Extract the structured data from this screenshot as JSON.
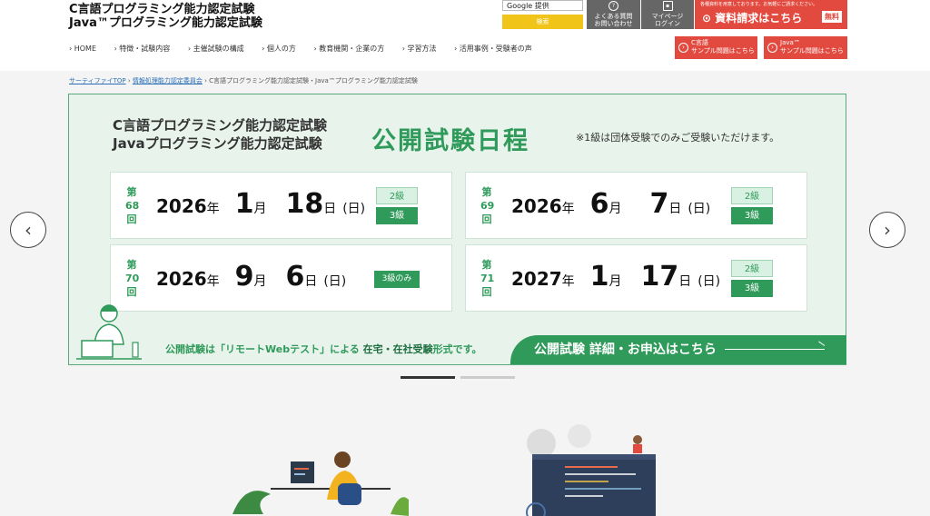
{
  "header": {
    "title_line1": "C言語プログラミング能力認定試験",
    "title_line2": "Java™プログラミング能力認定試験",
    "search_brand": "Google 提供",
    "search_button": "検索",
    "faq_label": "よくある質問\nお問い合わせ",
    "faq_line1": "よくある質問",
    "faq_line2": "お問い合わせ",
    "mypage_line1": "マイページ",
    "mypage_line2": "ログイン",
    "docreq_note": "各種資料を用意しております。お気軽にご請求ください。",
    "docreq_label": "資料請求はこちら",
    "docreq_free": "無料",
    "sample_c_line1": "C言語",
    "sample_c_line2": "サンプル問題はこちら",
    "sample_java_line1": "Java™",
    "sample_java_line2": "サンプル問題はこちら"
  },
  "nav": [
    "› HOME",
    "› 特徴・試験内容",
    "› 主催試験の構成",
    "› 個人の方",
    "› 教育機関・企業の方",
    "› 学習方法",
    "› 活用事例・受験者の声"
  ],
  "breadcrumb": {
    "item1": "サーティファイTOP",
    "item2": "情報処理能力認定委員会",
    "current": "C言語プログラミング能力認定試験・Java™プログラミング能力認定試験",
    "sep": "›"
  },
  "banner": {
    "title_line1": "C言語プログラミング能力認定試験",
    "title_line2": "Javaプログラミング能力認定試験",
    "heading": "公開試験日程",
    "note": "※1級は団体受験でのみご受験いただけます。",
    "sessions": [
      {
        "dai": "第",
        "num": "68",
        "kai": "回",
        "year": "2026",
        "month": "1",
        "day": "18",
        "weekday": "日",
        "grades": [
          "2級",
          "3級"
        ]
      },
      {
        "dai": "第",
        "num": "69",
        "kai": "回",
        "year": "2026",
        "month": "6",
        "day": "7",
        "weekday": "日",
        "grades": [
          "2級",
          "3級"
        ]
      },
      {
        "dai": "第",
        "num": "70",
        "kai": "回",
        "year": "2026",
        "month": "9",
        "day": "6",
        "weekday": "日",
        "grades": [
          "3級のみ"
        ]
      },
      {
        "dai": "第",
        "num": "71",
        "kai": "回",
        "year": "2027",
        "month": "1",
        "day": "17",
        "weekday": "日",
        "grades": [
          "2級",
          "3級"
        ]
      }
    ],
    "units": {
      "year": "年",
      "month": "月",
      "day": "日"
    },
    "foot_text_a": "公開試験は「リモートWebテスト」による",
    "foot_text_b": "在宅・在社受験",
    "foot_text_c": "形式です。",
    "cta": "公開試験 詳細・お申込はこちら"
  },
  "carousel": {
    "prev": "‹",
    "next": "›",
    "active_index": 0,
    "count": 2
  }
}
